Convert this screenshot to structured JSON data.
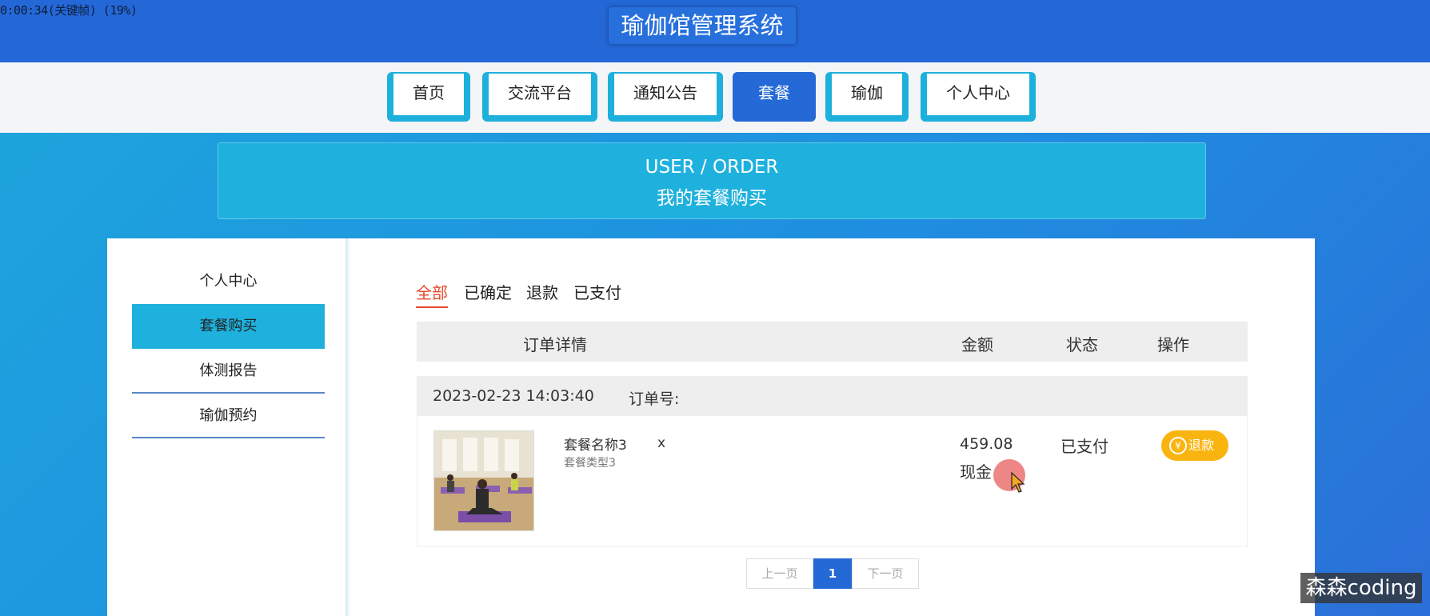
{
  "recorder_overlay": "0:00:34(关键帧) (19%)",
  "header": {
    "title": "瑜伽馆管理系统"
  },
  "nav": {
    "items": [
      {
        "label": "首页"
      },
      {
        "label": "交流平台"
      },
      {
        "label": "通知公告"
      },
      {
        "label": "套餐",
        "active": true
      },
      {
        "label": "瑜伽"
      },
      {
        "label": "个人中心"
      }
    ]
  },
  "banner": {
    "en": "USER / ORDER",
    "cn": "我的套餐购买"
  },
  "sidebar": {
    "items": [
      {
        "label": "个人中心"
      },
      {
        "label": "套餐购买",
        "active": true
      },
      {
        "label": "体测报告"
      },
      {
        "label": "瑜伽预约"
      }
    ]
  },
  "filters": [
    {
      "label": "全部",
      "active": true
    },
    {
      "label": "已确定"
    },
    {
      "label": "退款"
    },
    {
      "label": "已支付"
    }
  ],
  "table": {
    "headers": {
      "detail": "订单详情",
      "amount": "金额",
      "status": "状态",
      "action": "操作"
    }
  },
  "order": {
    "datetime": "2023-02-23 14:03:40",
    "order_no_label": "订单号:",
    "product_name": "套餐名称3",
    "product_type": "套餐类型3",
    "quantity": "x",
    "price": "459.08",
    "pay_type": "现金",
    "status": "已支付",
    "refund_label": "退款",
    "refund_icon_glyph": "¥",
    "thumb_icon": "yoga-class-photo"
  },
  "pagination": {
    "prev": "上一页",
    "current": "1",
    "next": "下一页"
  },
  "watermark": "森森coding",
  "colors": {
    "header": "#2468d8",
    "nav_active": "#2469d6",
    "accent_cyan": "#1fb1de",
    "active_filter": "#e8492c",
    "refund_button": "#f9b410"
  }
}
